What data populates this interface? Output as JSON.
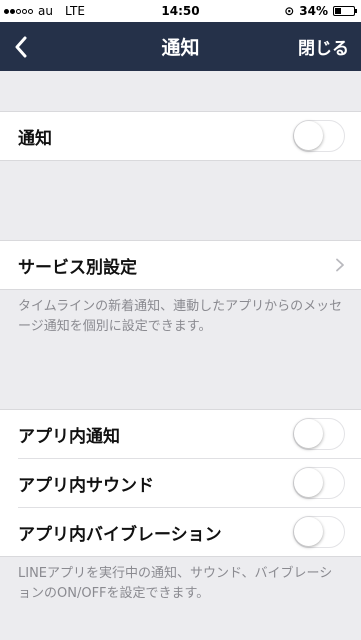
{
  "statusbar": {
    "carrier": "au",
    "network": "LTE",
    "time": "14:50",
    "battery": "34%",
    "battery_level": 0.34,
    "signal_bars": 2
  },
  "navbar": {
    "title": "通知",
    "close_label": "閉じる",
    "back_icon": "chevron-left-icon"
  },
  "sections": {
    "notifications": {
      "label": "通知",
      "enabled": false
    },
    "service": {
      "label": "サービス別設定",
      "footer": "タイムラインの新着通知、連動したアプリからのメッセージ通知を個別に設定できます。"
    },
    "in_app": {
      "items": [
        {
          "label": "アプリ内通知",
          "enabled": false
        },
        {
          "label": "アプリ内サウンド",
          "enabled": false
        },
        {
          "label": "アプリ内バイブレーション",
          "enabled": false
        }
      ],
      "footer": "LINEアプリを実行中の通知、サウンド、バイブレーションのON/OFFを設定できます。"
    }
  },
  "colors": {
    "navbar": "#253149",
    "background": "#ececef",
    "footer_text": "#8a8a90"
  }
}
